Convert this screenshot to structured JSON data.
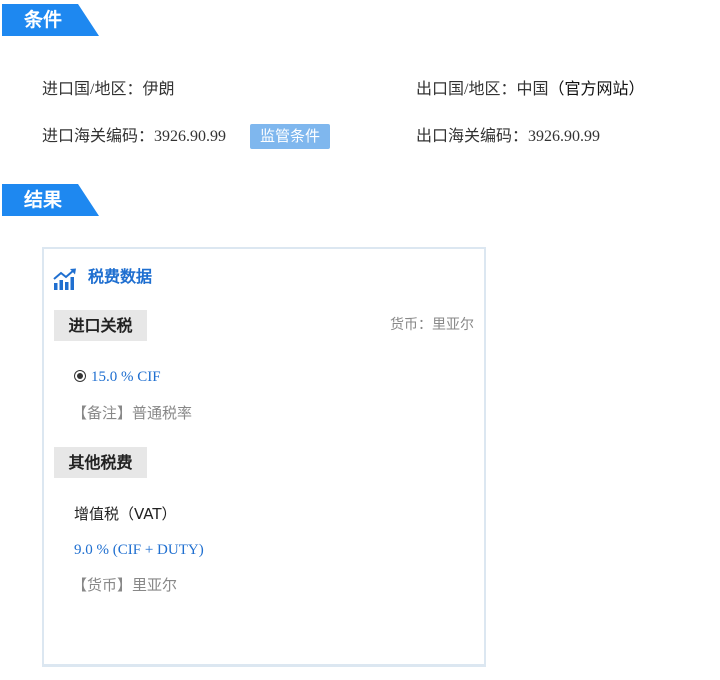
{
  "sections": {
    "conditions_title": "条件",
    "results_title": "结果"
  },
  "conditions": {
    "import_country_label": "进口国/地区：",
    "import_country_value": "伊朗",
    "export_country_label": "出口国/地区：",
    "export_country_value": "中国",
    "export_country_link": "（官方网站）",
    "import_hs_label": "进口海关编码：",
    "import_hs_value": "3926.90.99",
    "regulatory_button": "监管条件",
    "export_hs_label": "出口海关编码：",
    "export_hs_value": "3926.90.99"
  },
  "tax_panel": {
    "title": "税费数据",
    "title_icon": "bar-chart-trend-icon",
    "import_duty_tag": "进口关税",
    "currency_label": "货币：",
    "currency_value": "里亚尔",
    "duty_rate": "15.0 % CIF",
    "duty_note": "【备注】普通税率",
    "other_tax_tag": "其他税费",
    "vat_name": "增值税（VAT）",
    "vat_rate": "9.0 % (CIF + DUTY)",
    "vat_currency": "【货币】里亚尔"
  },
  "colors": {
    "accent": "#1e88f0",
    "button": "#7fb7ee",
    "link_blue": "#1f6fd0",
    "panel_border": "#dce7f1",
    "tag_bg": "#e7e7e7"
  }
}
